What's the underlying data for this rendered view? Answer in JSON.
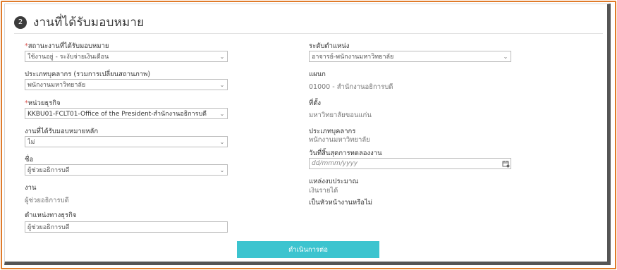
{
  "header": {
    "step": "2",
    "title": "งานที่ได้รับมอบหมาย"
  },
  "left": {
    "assignment_status": {
      "label": "สถานะงานที่ได้รับมอบหมาย",
      "required": "*",
      "value": "ใช้งานอยู่ - ระงับจ่ายเงินเดือน"
    },
    "personnel_type_change": {
      "label": "ประเภทบุคลากร (รวมการเปลี่ยนสถานภาพ)",
      "value": "พนักงานมหาวิทยาลัย"
    },
    "business_unit": {
      "label": "หน่วยธุรกิจ",
      "required": "*",
      "value": "KKBU01-FCLT01-Office of the President-สำนักงานอธิการบดี"
    },
    "primary_assignment": {
      "label": "งานที่ได้รับมอบหมายหลัก",
      "value": "ไม่"
    },
    "name": {
      "label": "ชื่อ",
      "value": "ผู้ช่วยอธิการบดี"
    },
    "job": {
      "label": "งาน",
      "value": "ผู้ช่วยอธิการบดี"
    },
    "business_title": {
      "label": "ตำแหน่งทางธุรกิจ",
      "value": "ผู้ช่วยอธิการบดี"
    }
  },
  "right": {
    "position_level": {
      "label": "ระดับตำแหน่ง",
      "value": "อาจารย์-พนักงานมหาวิทยาลัย"
    },
    "department": {
      "label": "แผนก",
      "value": "01000 - สำนักงานอธิการบดี"
    },
    "location": {
      "label": "ที่ตั้ง",
      "value": "มหาวิทยาลัยขอนแก่น"
    },
    "personnel_type": {
      "label": "ประเภทบุคลากร",
      "value": "พนักงานมหาวิทยาลัย"
    },
    "probation_end": {
      "label": "วันที่สิ้นสุดการทดลองงาน",
      "placeholder": "dd/mmm/yyyy"
    },
    "budget_source": {
      "label": "แหล่งงบประมาณ",
      "value": "เงินรายได้"
    },
    "is_supervisor": {
      "label": "เป็นหัวหน้างานหรือไม่"
    }
  },
  "actions": {
    "continue_label": "ดำเนินการต่อ"
  },
  "colors": {
    "accent": "#3cc4cf",
    "frame": "#e07b2a",
    "badge": "#3b3b3b",
    "required": "#d9534f"
  },
  "icons": {
    "dropdown": "chevron-down-icon",
    "date": "calendar-icon"
  }
}
